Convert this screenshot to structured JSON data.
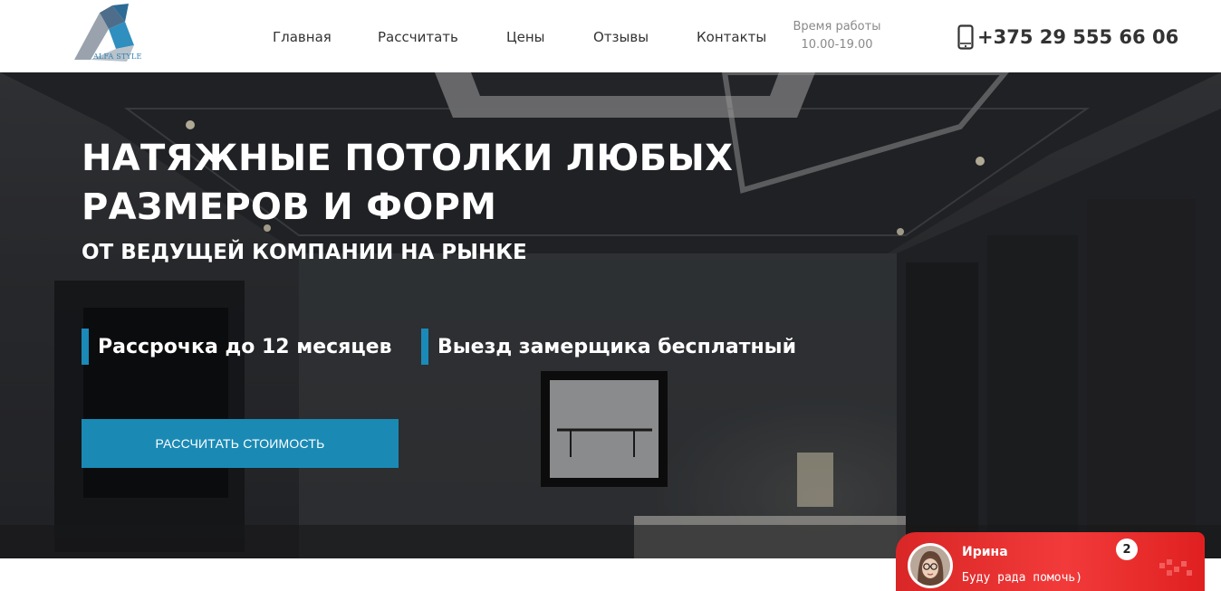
{
  "header": {
    "logo_text": "ALFA STYLE",
    "nav": [
      {
        "label": "Главная"
      },
      {
        "label": "Рассчитать"
      },
      {
        "label": "Цены"
      },
      {
        "label": "Отзывы"
      },
      {
        "label": "Контакты"
      }
    ],
    "work_hours_label": "Время работы",
    "work_hours_value": "10.00-19.00",
    "phone_icon": "mobile-phone-icon",
    "phone": "+375 29 555 66 06"
  },
  "hero": {
    "title": "НАТЯЖНЫЕ ПОТОЛКИ ЛЮБЫХ РАЗМЕРОВ И ФОРМ",
    "subtitle": "ОТ ВЕДУЩЕЙ КОМПАНИИ НА РЫНКЕ",
    "features": [
      {
        "label": "Рассрочка до 12 месяцев"
      },
      {
        "label": "Выезд замерщика бесплатный"
      }
    ],
    "cta_label": "РАССЧИТАТЬ СТОИМОСТЬ"
  },
  "chat": {
    "name": "Ирина",
    "message": "Буду рада помочь)",
    "unread_count": "2"
  },
  "colors": {
    "accent": "#1a8ab5",
    "chat_red": "#e02020"
  }
}
